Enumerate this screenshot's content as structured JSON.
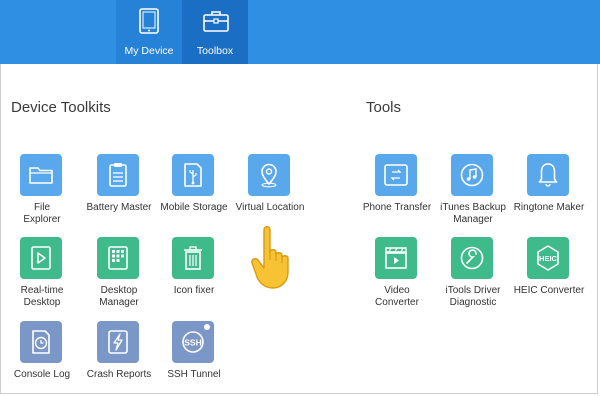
{
  "tabs": [
    {
      "label": "My Device",
      "icon": "tablet-icon"
    },
    {
      "label": "Toolbox",
      "icon": "toolbox-icon"
    }
  ],
  "sections": {
    "device_toolkits": {
      "title": "Device Toolkits",
      "items": [
        {
          "label": "File\nExplorer",
          "icon": "folder-icon",
          "color": "#5aa8ec"
        },
        {
          "label": "Battery Master",
          "icon": "clipboard-icon",
          "color": "#5aa8ec"
        },
        {
          "label": "Mobile Storage",
          "icon": "usb-storage-icon",
          "color": "#5aa8ec"
        },
        {
          "label": "Virtual Location",
          "icon": "location-pin-icon",
          "color": "#5aa8ec"
        },
        {
          "label": "Real-time\nDesktop",
          "icon": "play-window-icon",
          "color": "#3fba8a"
        },
        {
          "label": "Desktop\nManager",
          "icon": "app-grid-icon",
          "color": "#3fba8a"
        },
        {
          "label": "Icon fixer",
          "icon": "trash-icon",
          "color": "#3fba8a"
        },
        {
          "label": "Console Log",
          "icon": "clock-log-icon",
          "color": "#7b97c8"
        },
        {
          "label": "Crash Reports",
          "icon": "lightning-icon",
          "color": "#7b97c8"
        },
        {
          "label": "SSH Tunnel",
          "icon": "ssh-icon",
          "color": "#7b97c8"
        }
      ]
    },
    "tools": {
      "title": "Tools",
      "items": [
        {
          "label": "Phone Transfer",
          "icon": "phone-transfer-icon",
          "color": "#5aa8ec"
        },
        {
          "label": "iTunes Backup\nManager",
          "icon": "music-note-icon",
          "color": "#5aa8ec"
        },
        {
          "label": "Ringtone Maker",
          "icon": "bell-icon",
          "color": "#5aa8ec"
        },
        {
          "label": "Video\nConverter",
          "icon": "video-clapper-icon",
          "color": "#3fba8a"
        },
        {
          "label": "iTools Driver\nDiagnostic",
          "icon": "wrench-icon",
          "color": "#3fba8a"
        },
        {
          "label": "HEIC Converter",
          "icon": "heic-icon",
          "color": "#3fba8a"
        }
      ]
    }
  },
  "ssh_text": "SSH",
  "heic_text": "HEIC"
}
